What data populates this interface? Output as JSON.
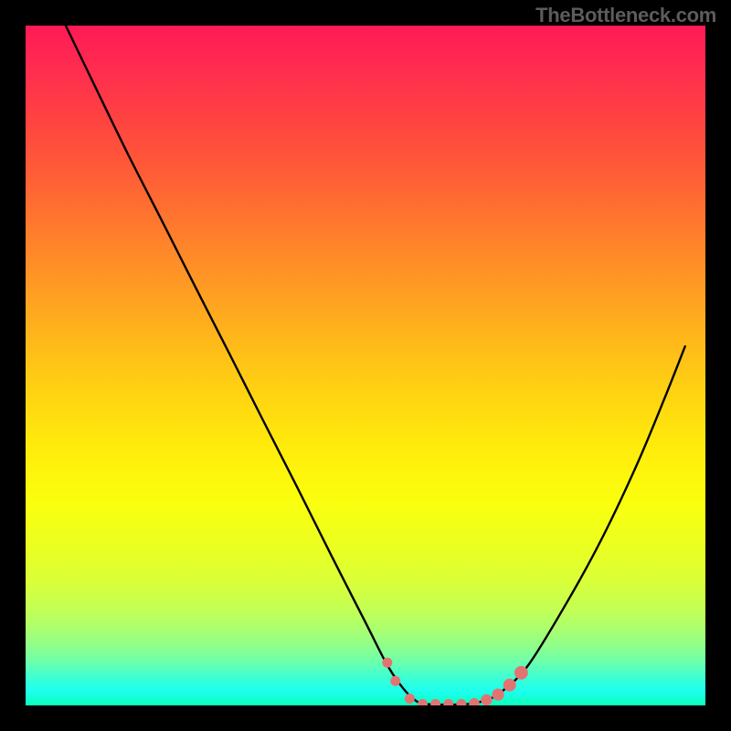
{
  "watermark": "TheBottleneck.com",
  "chart_data": {
    "type": "line",
    "title": "",
    "xlabel": "",
    "ylabel": "",
    "xlim": [
      0,
      100
    ],
    "ylim": [
      0,
      100
    ],
    "curve": {
      "name": "bottleneck-curve",
      "points": [
        {
          "x": 5.9,
          "y": 100
        },
        {
          "x": 10,
          "y": 91.5
        },
        {
          "x": 15,
          "y": 81.2
        },
        {
          "x": 20,
          "y": 71.4
        },
        {
          "x": 25,
          "y": 61.5
        },
        {
          "x": 30,
          "y": 51.7
        },
        {
          "x": 35,
          "y": 41.8
        },
        {
          "x": 40,
          "y": 32.0
        },
        {
          "x": 45,
          "y": 22.0
        },
        {
          "x": 50,
          "y": 12.2
        },
        {
          "x": 53,
          "y": 6.3
        },
        {
          "x": 55,
          "y": 3.2
        },
        {
          "x": 57,
          "y": 1.0
        },
        {
          "x": 59,
          "y": 0.2
        },
        {
          "x": 65,
          "y": 0.2
        },
        {
          "x": 68,
          "y": 0.9
        },
        {
          "x": 70,
          "y": 2.0
        },
        {
          "x": 74,
          "y": 6.0
        },
        {
          "x": 80,
          "y": 15.8
        },
        {
          "x": 85,
          "y": 25.0
        },
        {
          "x": 90,
          "y": 35.6
        },
        {
          "x": 94,
          "y": 45.2
        },
        {
          "x": 97,
          "y": 52.8
        }
      ]
    },
    "highlight_dots": {
      "name": "optimal-range",
      "color": "#e27373",
      "points": [
        {
          "x": 53.2,
          "y": 6.3,
          "r": 5.5
        },
        {
          "x": 54.4,
          "y": 3.6,
          "r": 5.5
        },
        {
          "x": 56.5,
          "y": 1.0,
          "r": 5.5
        },
        {
          "x": 58.4,
          "y": 0.2,
          "r": 5.5
        },
        {
          "x": 60.3,
          "y": 0.2,
          "r": 5.5
        },
        {
          "x": 62.2,
          "y": 0.2,
          "r": 5.5
        },
        {
          "x": 64.1,
          "y": 0.2,
          "r": 5.5
        },
        {
          "x": 66.0,
          "y": 0.3,
          "r": 5.8
        },
        {
          "x": 67.8,
          "y": 0.8,
          "r": 6.2
        },
        {
          "x": 69.5,
          "y": 1.6,
          "r": 6.6
        },
        {
          "x": 71.2,
          "y": 3.0,
          "r": 7.0
        },
        {
          "x": 72.9,
          "y": 4.8,
          "r": 7.4
        }
      ]
    },
    "background": {
      "type": "vertical-gradient",
      "stops": [
        {
          "offset": 0,
          "color": "#ff1a55"
        },
        {
          "offset": 100,
          "color": "#0affba"
        }
      ]
    }
  }
}
